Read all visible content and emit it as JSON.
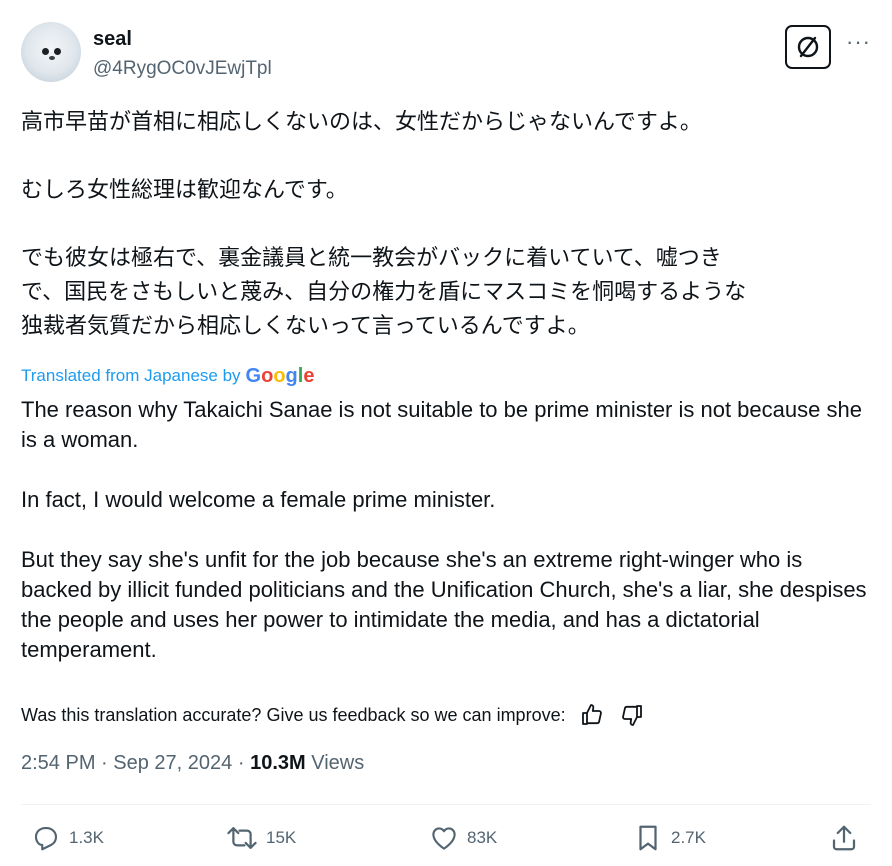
{
  "author": {
    "name": "seal",
    "handle": "@4RygOC0vJEwjTpl"
  },
  "icons": {
    "grok": "grok-slash-icon",
    "more": "more-icon",
    "reply": "reply-icon",
    "retweet": "retweet-icon",
    "like": "like-icon",
    "bookmark": "bookmark-icon",
    "share": "share-icon",
    "thumbs_up": "thumbs-up-icon",
    "thumbs_down": "thumbs-down-icon"
  },
  "more_label": "···",
  "original_text": [
    "高市早苗が首相に相応しくないのは、女性だからじゃないんですよ。",
    "むしろ女性総理は歓迎なんです。",
    "でも彼女は極右で、裏金議員と統一教会がバックに着いていて、嘘つき\nで、国民をさもしいと蔑み、自分の権力を盾にマスコミを恫喝するような\n独裁者気質だから相応しくないって言っているんですよ。"
  ],
  "translation": {
    "label": "Translated from Japanese by",
    "provider": "Google",
    "paragraphs": [
      "The reason why Takaichi Sanae is not suitable to be prime minister is not because she is a woman.",
      "In fact, I would welcome a female prime minister.",
      "But they say she's unfit for the job because she's an extreme right-winger who is backed by illicit funded politicians and the Unification Church, she's a liar, she despises the people and uses her power to intimidate the media, and has a dictatorial temperament."
    ],
    "feedback_prompt": "Was this translation accurate? Give us feedback so we can improve:"
  },
  "meta": {
    "time": "2:54 PM",
    "date": "Sep 27, 2024",
    "separator": "·",
    "views_count": "10.3M",
    "views_label": "Views"
  },
  "actions": {
    "replies": "1.3K",
    "retweets": "15K",
    "likes": "83K",
    "bookmarks": "2.7K"
  },
  "colors": {
    "link": "#1d9bf0",
    "secondary": "#536471",
    "primary": "#0f1419"
  }
}
